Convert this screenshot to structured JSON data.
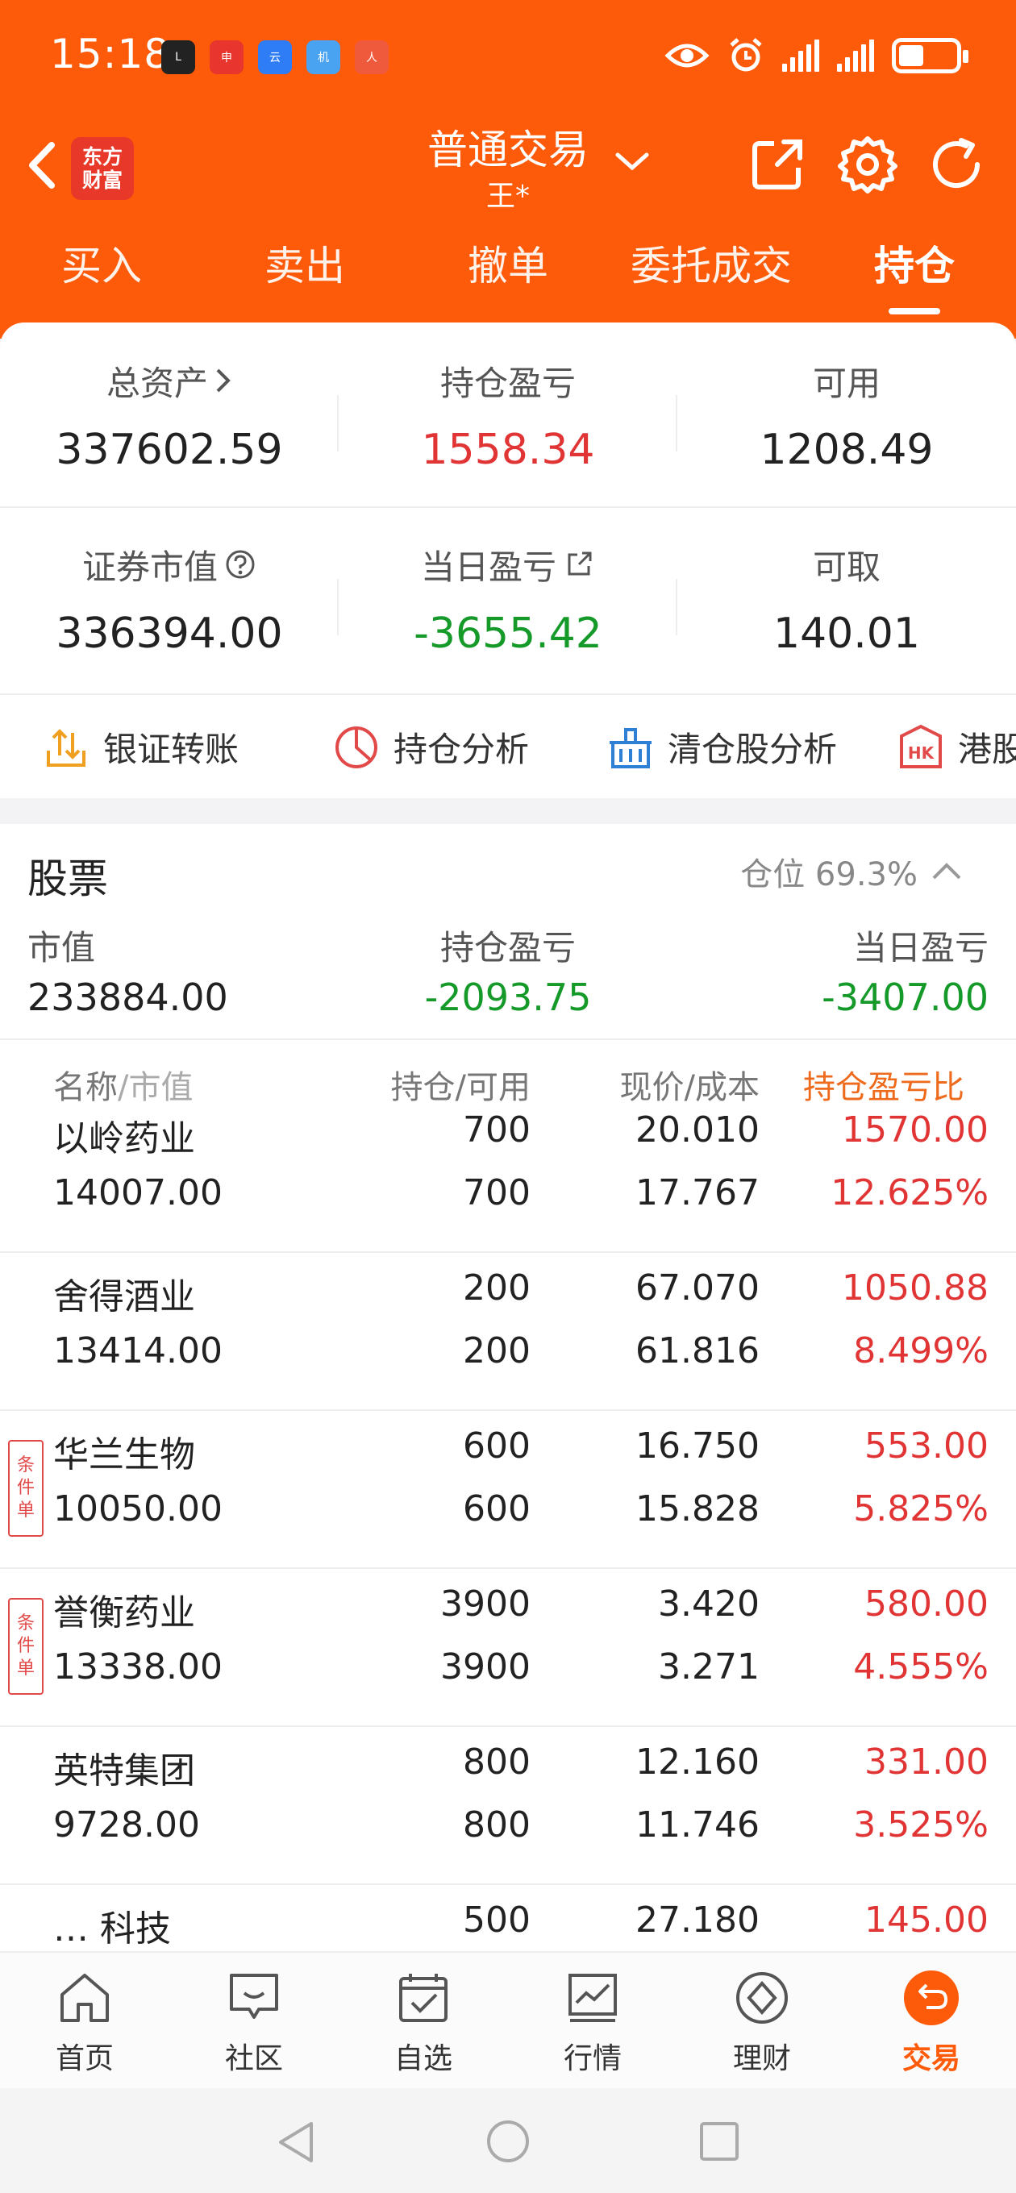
{
  "status_bar": {
    "time": "15:18",
    "app_icons": [
      "L",
      "申",
      "云",
      "机",
      "人"
    ]
  },
  "brand": {
    "line1": "东方",
    "line2": "财富"
  },
  "header": {
    "title": "普通交易",
    "subtitle": "王*"
  },
  "tabs": [
    {
      "label": "买入",
      "active": false
    },
    {
      "label": "卖出",
      "active": false
    },
    {
      "label": "撤单",
      "active": false
    },
    {
      "label": "委托成交",
      "active": false
    },
    {
      "label": "持仓",
      "active": true
    }
  ],
  "summary": {
    "total_assets": {
      "label": "总资产",
      "value": "337602.59"
    },
    "position_pl": {
      "label": "持仓盈亏",
      "value": "1558.34"
    },
    "available": {
      "label": "可用",
      "value": "1208.49"
    },
    "market_value": {
      "label": "证券市值",
      "value": "336394.00"
    },
    "daily_pl": {
      "label": "当日盈亏",
      "value": "-3655.42"
    },
    "withdrawable": {
      "label": "可取",
      "value": "140.01"
    }
  },
  "quick_tools": [
    {
      "label": "银证转账",
      "icon": "transfer-icon"
    },
    {
      "label": "持仓分析",
      "icon": "pie-chart-icon"
    },
    {
      "label": "清仓股分析",
      "icon": "basket-icon"
    },
    {
      "label": "港股",
      "icon": "hk-icon"
    }
  ],
  "stocks_section": {
    "title": "股票",
    "position_ratio": "仓位 69.3%",
    "market_value_label": "市值",
    "market_value": "233884.00",
    "position_pl_label": "持仓盈亏",
    "position_pl": "-2093.75",
    "daily_pl_label": "当日盈亏",
    "daily_pl": "-3407.00"
  },
  "table_headers": {
    "name": "名称",
    "value": "/市值",
    "holding": "持仓/可用",
    "price": "现价/成本",
    "pl_ratio": "持仓盈亏比"
  },
  "condition_tag": "条件单",
  "holdings": [
    {
      "name": "以岭药业",
      "market_value": "14007.00",
      "holding": "700",
      "available": "700",
      "price": "20.010",
      "cost": "17.767",
      "pl": "1570.00",
      "pl_pct": "12.625%",
      "conditional": false
    },
    {
      "name": "舍得酒业",
      "market_value": "13414.00",
      "holding": "200",
      "available": "200",
      "price": "67.070",
      "cost": "61.816",
      "pl": "1050.88",
      "pl_pct": "8.499%",
      "conditional": false
    },
    {
      "name": "华兰生物",
      "market_value": "10050.00",
      "holding": "600",
      "available": "600",
      "price": "16.750",
      "cost": "15.828",
      "pl": "553.00",
      "pl_pct": "5.825%",
      "conditional": true
    },
    {
      "name": "誉衡药业",
      "market_value": "13338.00",
      "holding": "3900",
      "available": "3900",
      "price": "3.420",
      "cost": "3.271",
      "pl": "580.00",
      "pl_pct": "4.555%",
      "conditional": true
    },
    {
      "name": "英特集团",
      "market_value": "9728.00",
      "holding": "800",
      "available": "800",
      "price": "12.160",
      "cost": "11.746",
      "pl": "331.00",
      "pl_pct": "3.525%",
      "conditional": false
    },
    {
      "name": "… 科技",
      "market_value": "",
      "holding": "500",
      "available": "",
      "price": "27.180",
      "cost": "",
      "pl": "145.00",
      "pl_pct": "",
      "conditional": false
    }
  ],
  "bottom_nav": [
    {
      "label": "首页",
      "icon": "home-icon",
      "active": false
    },
    {
      "label": "社区",
      "icon": "chat-icon",
      "active": false
    },
    {
      "label": "自选",
      "icon": "checkbox-icon",
      "active": false
    },
    {
      "label": "行情",
      "icon": "trend-chart-icon",
      "active": false
    },
    {
      "label": "理财",
      "icon": "diamond-icon",
      "active": false
    },
    {
      "label": "交易",
      "icon": "trade-icon",
      "active": true
    }
  ],
  "colors": {
    "brand_orange": "#fd5a09",
    "gain_red": "#e13535",
    "loss_green": "#159a2a"
  }
}
